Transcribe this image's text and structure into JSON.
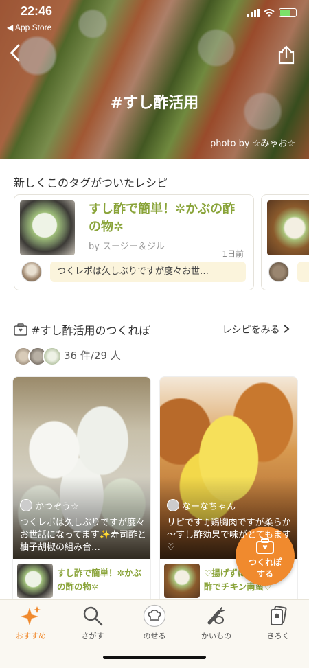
{
  "status_bar": {
    "time": "22:46",
    "back_app": "◀ App Store"
  },
  "hero": {
    "title": "#すし酢活用",
    "credit": "photo by ☆みゃお☆"
  },
  "new_recipes": {
    "heading": "新しくこのタグがついたレシピ",
    "cards": [
      {
        "title": "すし酢で簡単！✲かぶの酢の物✲",
        "author": "by スージー＆ジル",
        "date": "1日前",
        "comment": "つくレポは久しぶりですが度々お世…"
      }
    ]
  },
  "tsukurepo": {
    "heading": "#すし酢活用のつくれぽ",
    "more_link": "レシピをみる",
    "count": "36 件/29 人",
    "cards": [
      {
        "user": "かつぞう☆",
        "text": "つくレポは久しぶりですが度々お世話になってます✨寿司酢と柚子胡椒の組み合…",
        "recipe_title": "すし酢で簡単！✲かぶの酢の物✲"
      },
      {
        "user": "なーなちゃん",
        "text": "リピです♫鶏胸肉ですが柔らか～すし酢効果で味がとてもます♡",
        "recipe_title": "♡揚げずに簡単♡すし酢でチキン南蛮♡"
      }
    ]
  },
  "fab": {
    "label_line1": "つくれぽ",
    "label_line2": "する"
  },
  "tabs": [
    {
      "label": "おすすめ",
      "icon": "sparkle-icon"
    },
    {
      "label": "さがす",
      "icon": "search-icon"
    },
    {
      "label": "のせる",
      "icon": "chef-hat-icon"
    },
    {
      "label": "かいもの",
      "icon": "vegetables-icon"
    },
    {
      "label": "きろく",
      "icon": "cards-icon"
    }
  ],
  "colors": {
    "accent": "#f08a2e",
    "recipe_title": "#8aa43a",
    "comment_bg": "#fbf4dc"
  }
}
